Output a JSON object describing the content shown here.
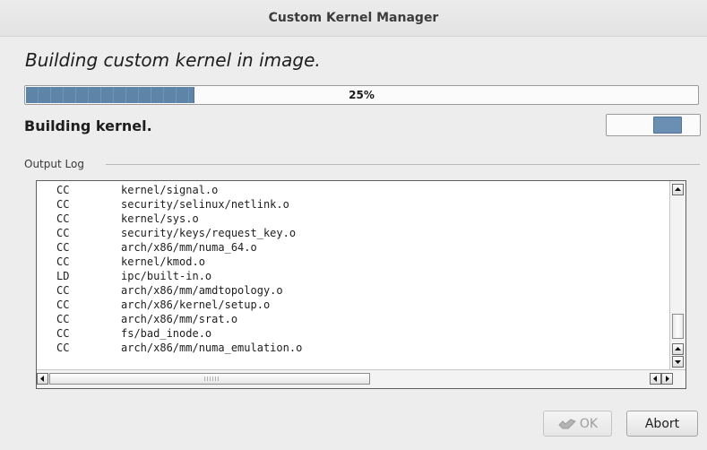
{
  "window": {
    "title": "Custom Kernel Manager"
  },
  "heading": "Building custom kernel in image.",
  "progress": {
    "value": 0.25,
    "label": "25%"
  },
  "status": "Building kernel.",
  "log": {
    "frame_label": "Output Log",
    "lines": [
      {
        "cmd": "CC",
        "file": "kernel/signal.o"
      },
      {
        "cmd": "CC",
        "file": "security/selinux/netlink.o"
      },
      {
        "cmd": "CC",
        "file": "kernel/sys.o"
      },
      {
        "cmd": "CC",
        "file": "security/keys/request_key.o"
      },
      {
        "cmd": "CC",
        "file": "arch/x86/mm/numa_64.o"
      },
      {
        "cmd": "CC",
        "file": "kernel/kmod.o"
      },
      {
        "cmd": "LD",
        "file": "ipc/built-in.o"
      },
      {
        "cmd": "CC",
        "file": "arch/x86/mm/amdtopology.o"
      },
      {
        "cmd": "CC",
        "file": "arch/x86/kernel/setup.o"
      },
      {
        "cmd": "CC",
        "file": "arch/x86/mm/srat.o"
      },
      {
        "cmd": "CC",
        "file": "fs/bad_inode.o"
      },
      {
        "cmd": "CC",
        "file": "arch/x86/mm/numa_emulation.o"
      }
    ]
  },
  "buttons": {
    "ok": "OK",
    "abort": "Abort"
  },
  "colors": {
    "progress_fill": "#5e84a8",
    "pulse_block": "#6a8fb3"
  }
}
